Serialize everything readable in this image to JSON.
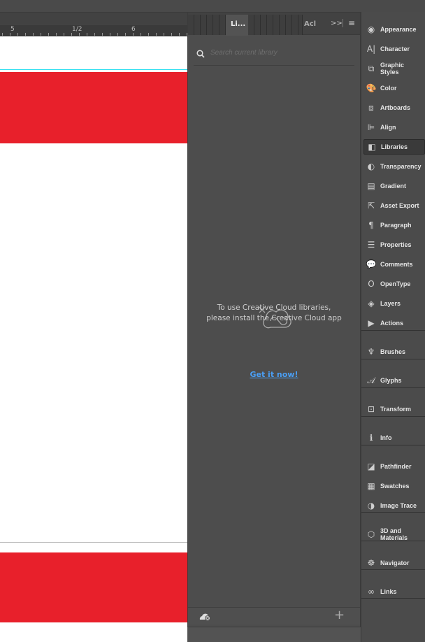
{
  "ruler": {
    "labels": [
      "5",
      "1/2",
      "6"
    ]
  },
  "libraries_panel": {
    "tabs": [
      {
        "label": "Li..."
      },
      {
        "label": "Acl"
      }
    ],
    "overflow_label": ">>",
    "search": {
      "placeholder": "Search current library",
      "value": ""
    },
    "message_line1": "To use Creative Cloud libraries,",
    "message_line2": "please install the Creative Cloud app",
    "link": "Get it now!"
  },
  "dock": {
    "items": [
      {
        "label": "Appearance",
        "icon": "appearance-icon"
      },
      {
        "label": "Character",
        "icon": "character-icon"
      },
      {
        "label": "Graphic Styles",
        "icon": "graphic-styles-icon"
      },
      {
        "label": "Color",
        "icon": "color-palette-icon"
      },
      {
        "label": "Artboards",
        "icon": "artboards-icon"
      },
      {
        "label": "Align",
        "icon": "align-icon"
      },
      {
        "label": "Libraries",
        "icon": "libraries-icon",
        "active": true
      },
      {
        "label": "Transparency",
        "icon": "transparency-icon"
      },
      {
        "label": "Gradient",
        "icon": "gradient-icon"
      },
      {
        "label": "Asset Export",
        "icon": "asset-export-icon"
      },
      {
        "label": "Paragraph",
        "icon": "paragraph-icon"
      },
      {
        "label": "Properties",
        "icon": "properties-icon"
      },
      {
        "label": "Comments",
        "icon": "comments-icon"
      },
      {
        "label": "OpenType",
        "icon": "opentype-icon"
      },
      {
        "label": "Layers",
        "icon": "layers-icon"
      },
      {
        "label": "Actions",
        "icon": "actions-icon"
      },
      {
        "label": "Brushes",
        "icon": "brushes-icon"
      },
      {
        "label": "Glyphs",
        "icon": "glyphs-icon"
      },
      {
        "label": "Transform",
        "icon": "transform-icon"
      },
      {
        "label": "Info",
        "icon": "info-icon"
      },
      {
        "label": "Pathfinder",
        "icon": "pathfinder-icon"
      },
      {
        "label": "Swatches",
        "icon": "swatches-icon"
      },
      {
        "label": "Image Trace",
        "icon": "image-trace-icon"
      },
      {
        "label": "3D and Materials",
        "icon": "3d-cube-icon"
      },
      {
        "label": "Navigator",
        "icon": "navigator-icon"
      },
      {
        "label": "Links",
        "icon": "links-icon"
      }
    ]
  },
  "colors": {
    "accent_red": "#e8202b",
    "link": "#4a9ff5",
    "guide": "#33e0f0"
  }
}
